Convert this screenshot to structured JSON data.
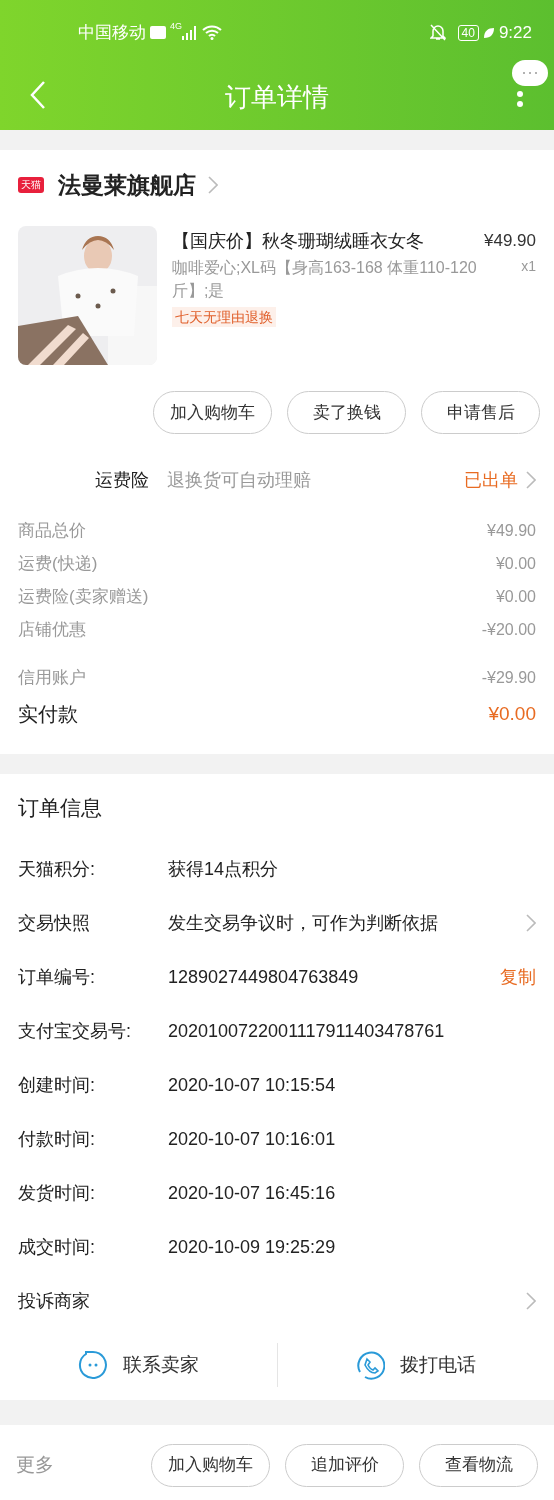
{
  "status_bar": {
    "carrier": "中国移动",
    "network": "4G",
    "battery": "40",
    "time": "9:22"
  },
  "header": {
    "title": "订单详情"
  },
  "store": {
    "badge": "天猫",
    "name": "法曼莱旗舰店"
  },
  "product": {
    "title": "【国庆价】秋冬珊瑚绒睡衣女冬",
    "spec": "咖啡爱心;XL码【身高163-168 体重110-120斤】;是",
    "tag": "七天无理由退换",
    "price": "¥49.90",
    "quantity": "x1"
  },
  "item_buttons": [
    "加入购物车",
    "卖了换钱",
    "申请售后"
  ],
  "insurance": {
    "label": "运费险",
    "description": "退换货可自动理赔",
    "status": "已出单"
  },
  "fees": [
    {
      "label": "商品总价",
      "value": "¥49.90",
      "kind": "normal"
    },
    {
      "label": "运费(快递)",
      "value": "¥0.00",
      "kind": "normal"
    },
    {
      "label": "运费险(卖家赠送)",
      "value": "¥0.00",
      "kind": "normal"
    },
    {
      "label": "店铺优惠",
      "value": "-¥20.00",
      "kind": "normal"
    },
    {
      "label": "信用账户",
      "value": "-¥29.90",
      "kind": "spaced"
    },
    {
      "label": "实付款",
      "value": "¥0.00",
      "kind": "total"
    }
  ],
  "order_info": {
    "title": "订单信息",
    "rows": [
      {
        "label": "天猫积分:",
        "value": "获得14点积分",
        "kind": "plain"
      },
      {
        "label": "交易快照",
        "value": "发生交易争议时，可作为判断依据",
        "kind": "link"
      },
      {
        "label": "订单编号:",
        "value": "1289027449804763849",
        "kind": "copy",
        "action": "复制"
      },
      {
        "label": "支付宝交易号:",
        "value": "2020100722001117911403478761",
        "kind": "plain"
      },
      {
        "label": "创建时间:",
        "value": "2020-10-07 10:15:54",
        "kind": "plain"
      },
      {
        "label": "付款时间:",
        "value": "2020-10-07 10:16:01",
        "kind": "plain"
      },
      {
        "label": "发货时间:",
        "value": "2020-10-07 16:45:16",
        "kind": "plain"
      },
      {
        "label": "成交时间:",
        "value": "2020-10-09 19:25:29",
        "kind": "plain"
      },
      {
        "label": "投诉商家",
        "value": "",
        "kind": "link"
      }
    ]
  },
  "contact": [
    {
      "label": "联系卖家",
      "kind": "chat"
    },
    {
      "label": "拨打电话",
      "kind": "phone"
    }
  ],
  "footer": {
    "more": "更多",
    "buttons": [
      "加入购物车",
      "追加评价",
      "查看物流"
    ]
  }
}
